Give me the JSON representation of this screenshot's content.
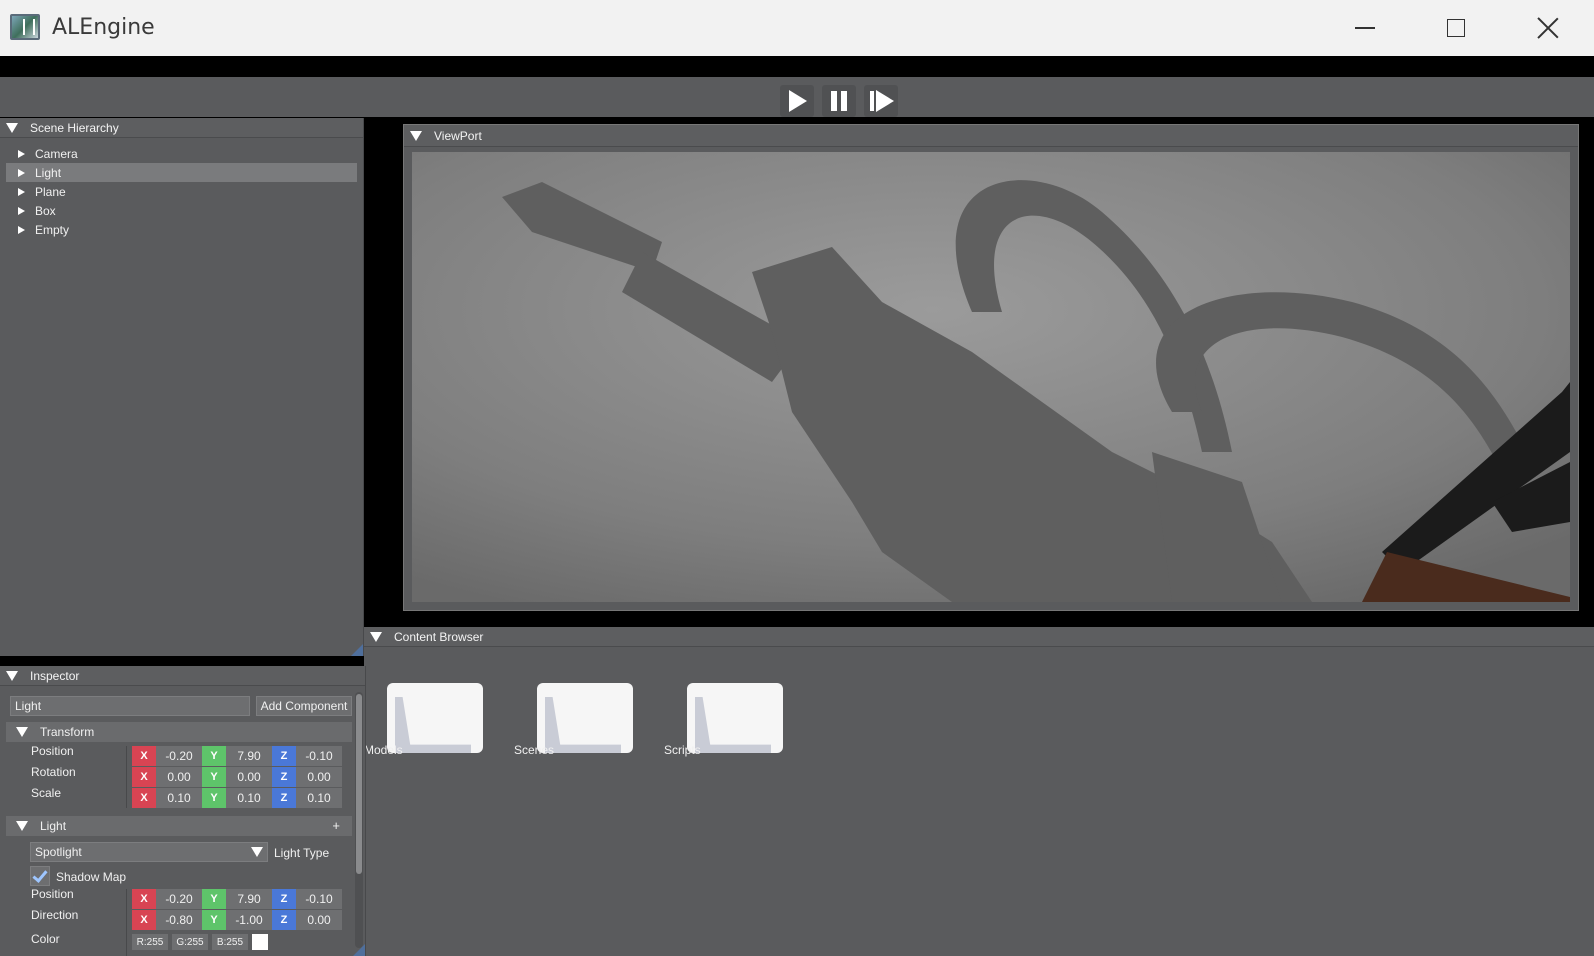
{
  "window": {
    "title": "ALEngine"
  },
  "toolbar": {
    "play": "play",
    "pause": "pause",
    "step": "step"
  },
  "hierarchy": {
    "title": "Scene Hierarchy",
    "items": [
      {
        "label": "Camera",
        "selected": false
      },
      {
        "label": "Light",
        "selected": true
      },
      {
        "label": "Plane",
        "selected": false
      },
      {
        "label": "Box",
        "selected": false
      },
      {
        "label": "Empty",
        "selected": false
      }
    ]
  },
  "viewport": {
    "title": "ViewPort"
  },
  "content_browser": {
    "title": "Content Browser",
    "folders": [
      {
        "label": "Models"
      },
      {
        "label": "Scenes"
      },
      {
        "label": "Scripts"
      }
    ]
  },
  "inspector": {
    "title": "Inspector",
    "name_value": "Light",
    "add_component_label": "Add Component",
    "transform": {
      "title": "Transform",
      "rows": [
        {
          "label": "Position",
          "x": "-0.20",
          "y": "7.90",
          "z": "-0.10"
        },
        {
          "label": "Rotation",
          "x": "0.00",
          "y": "0.00",
          "z": "0.00"
        },
        {
          "label": "Scale",
          "x": "0.10",
          "y": "0.10",
          "z": "0.10"
        }
      ]
    },
    "light": {
      "title": "Light",
      "add": "+",
      "type_value": "Spotlight",
      "type_label": "Light Type",
      "shadow_map_label": "Shadow Map",
      "shadow_map_checked": true,
      "rows": [
        {
          "label": "Position",
          "x": "-0.20",
          "y": "7.90",
          "z": "-0.10"
        },
        {
          "label": "Direction",
          "x": "-0.80",
          "y": "-1.00",
          "z": "0.00"
        }
      ],
      "color_label": "Color",
      "color_r": "R:255",
      "color_g": "G:255",
      "color_b": "B:255"
    },
    "axis_labels": {
      "x": "X",
      "y": "Y",
      "z": "Z"
    }
  },
  "colors": {
    "panel_bg": "#5a5b5d",
    "axis_x": "#d84453",
    "axis_y": "#5ec46a",
    "axis_z": "#4a78d8"
  }
}
